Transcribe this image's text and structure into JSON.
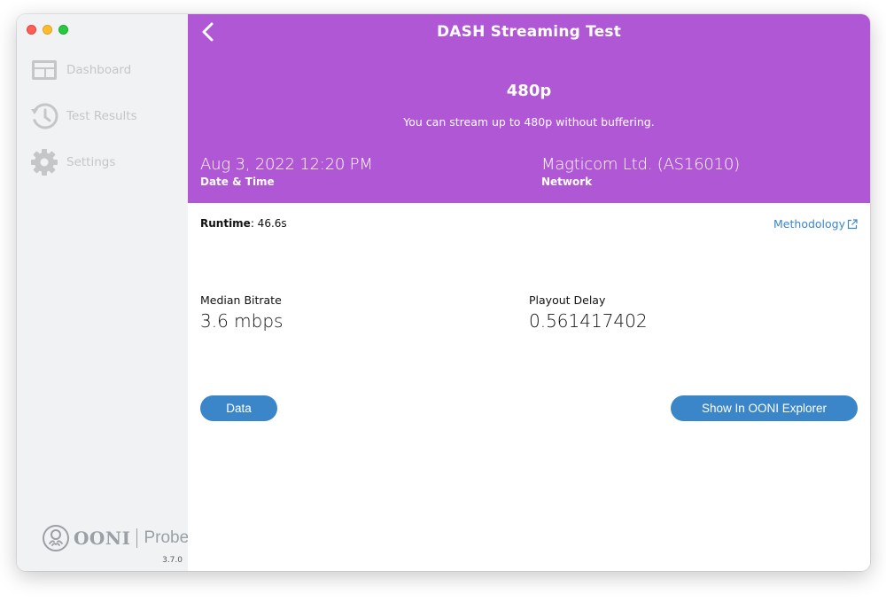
{
  "sidebar": {
    "items": [
      {
        "label": "Dashboard",
        "icon": "dashboard-icon"
      },
      {
        "label": "Test Results",
        "icon": "history-icon"
      },
      {
        "label": "Settings",
        "icon": "gear-icon"
      }
    ],
    "brand": {
      "ooni": "OONI",
      "probe": "Probe"
    },
    "version": "3.7.0"
  },
  "header": {
    "title": "DASH Streaming Test",
    "resolution": "480p",
    "description": "You can stream up to 480p without buffering.",
    "date_value": "Aug 3, 2022 12:20 PM",
    "date_label": "Date & Time",
    "network_value": "Magticom Ltd. (AS16010)",
    "network_label": "Network",
    "background_color": "#b057d6"
  },
  "details": {
    "runtime_label": "Runtime",
    "runtime_value": ": 46.6s",
    "methodology_label": "Methodology",
    "metrics": [
      {
        "label": "Median Bitrate",
        "value": "3.6 mbps"
      },
      {
        "label": "Playout Delay",
        "value": "0.561417402"
      }
    ],
    "data_button": "Data",
    "explorer_button": "Show In OONI Explorer",
    "accent_color": "#3a86c8"
  }
}
